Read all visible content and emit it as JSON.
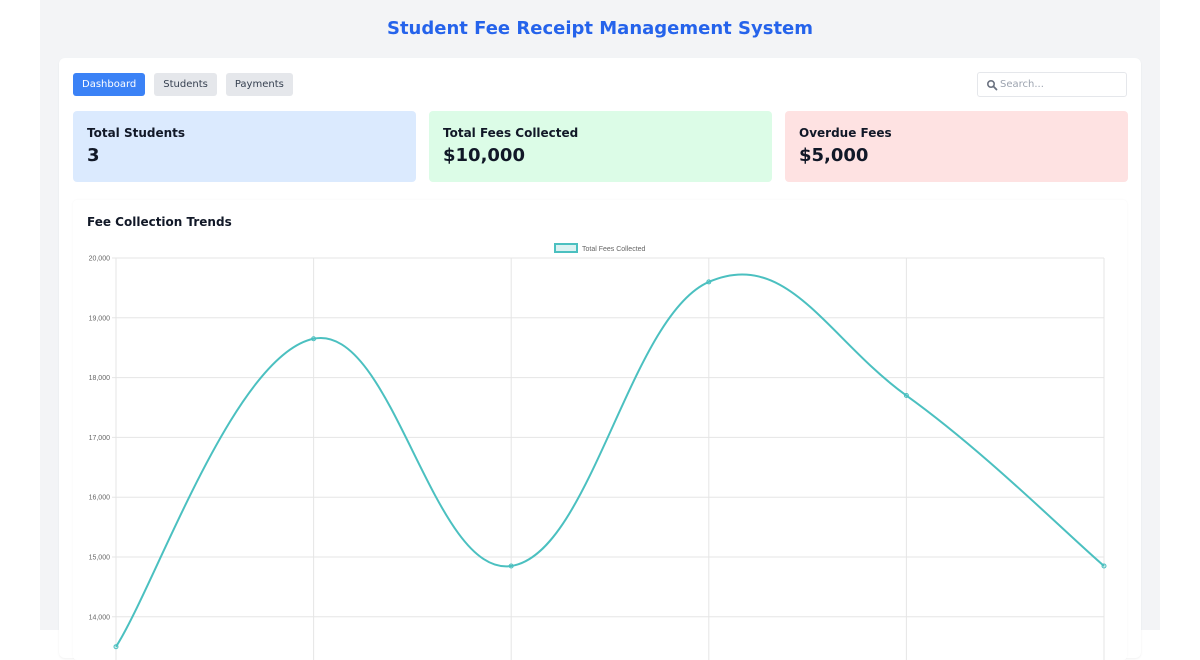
{
  "app": {
    "title": "Student Fee Receipt Management System"
  },
  "nav": {
    "items": [
      {
        "label": "Dashboard",
        "active": true
      },
      {
        "label": "Students",
        "active": false
      },
      {
        "label": "Payments",
        "active": false
      }
    ]
  },
  "search": {
    "placeholder": "Search..."
  },
  "cards": [
    {
      "label": "Total Students",
      "value": "3",
      "bg": "#dbeafe"
    },
    {
      "label": "Total Fees Collected",
      "value": "$10,000",
      "bg": "#dcfce7"
    },
    {
      "label": "Overdue Fees",
      "value": "$5,000",
      "bg": "#fee2e2"
    }
  ],
  "chart": {
    "title": "Fee Collection Trends"
  },
  "chart_data": {
    "type": "line",
    "x": [
      0,
      1,
      2,
      3,
      4,
      5
    ],
    "series": [
      {
        "name": "Total Fees Collected",
        "values": [
          13500,
          18650,
          14850,
          19600,
          17700,
          14850
        ],
        "color": "#4bc0c0"
      }
    ],
    "ylim": [
      13500,
      20000
    ],
    "yticks": [
      "20,000",
      "19,000",
      "18,000",
      "17,000",
      "16,000",
      "15,000",
      "14,000"
    ],
    "ytick_values": [
      20000,
      19000,
      18000,
      17000,
      16000,
      15000,
      14000
    ],
    "grid": true,
    "legend": "top"
  }
}
